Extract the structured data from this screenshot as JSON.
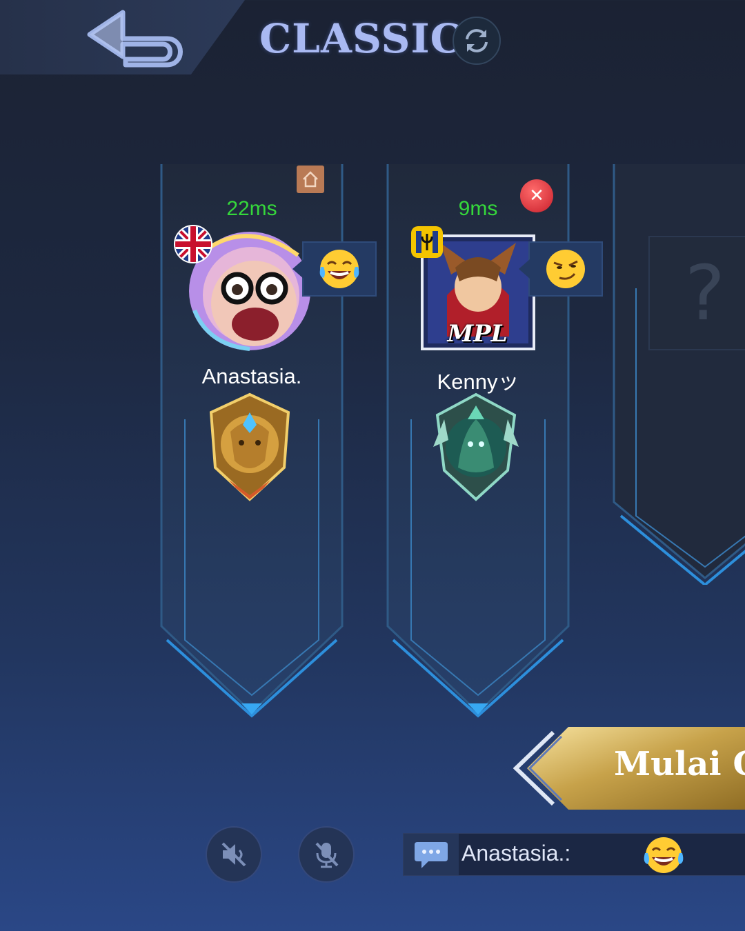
{
  "header": {
    "back_icon": "back-arrow-icon",
    "mode_title": "CLASSIC",
    "refresh_icon": "refresh-icon"
  },
  "players": [
    {
      "ping": "22ms",
      "name": "Anastasia.",
      "flag_icon": "uk-flag-icon",
      "badge_icon": "home-icon",
      "emote_icon": "laughing-tears-emoji-icon",
      "rank_icon": "gold-lion-rank-icon",
      "ping_color": "#35d83b"
    },
    {
      "ping": "9ms",
      "name": "Kennyッ",
      "flag_icon": "trident-flag-icon",
      "badge_icon": "kick-icon",
      "emote_icon": "smirk-emoji-icon",
      "rank_icon": "green-dragon-rank-icon",
      "avatar_text": "MPL",
      "ping_color": "#35d83b"
    }
  ],
  "empty_slot": {
    "symbol": "?"
  },
  "start_button": {
    "label": "Mulai G"
  },
  "bottom": {
    "speaker_icon": "speaker-muted-icon",
    "mic_icon": "mic-muted-icon",
    "chat_icon": "chat-bubble-icon",
    "chat_message": "Anastasia.:",
    "chat_emoji_icon": "laughing-tears-emoji-icon"
  }
}
